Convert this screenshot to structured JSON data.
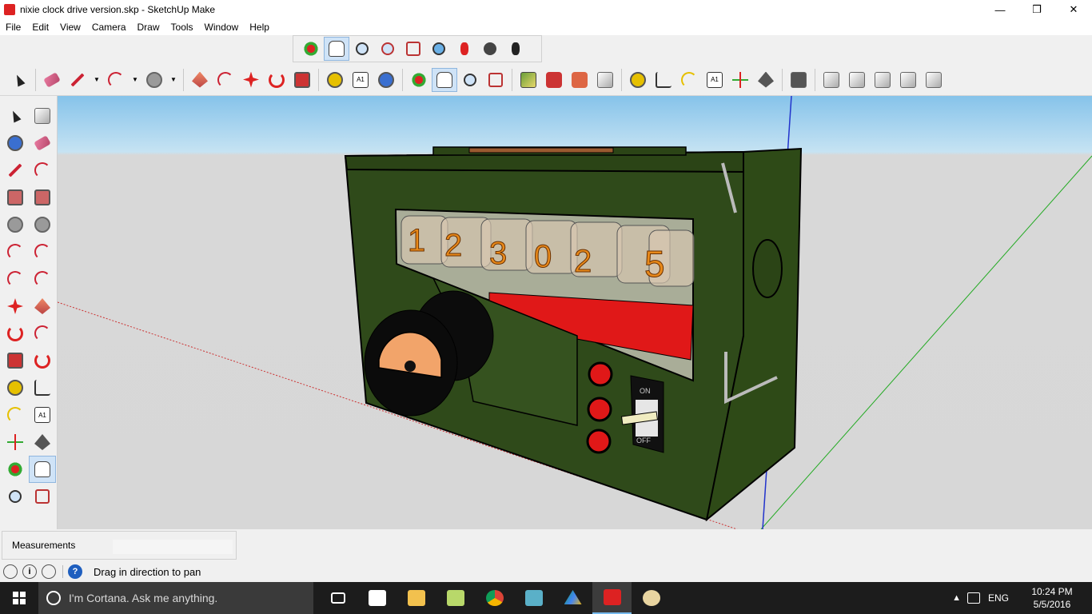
{
  "window": {
    "title": "nixie clock drive version.skp - SketchUp Make",
    "minimize": "—",
    "restore": "❒",
    "close": "✕"
  },
  "menu": [
    "File",
    "Edit",
    "View",
    "Camera",
    "Draw",
    "Tools",
    "Window",
    "Help"
  ],
  "toolbar": {
    "floating_tools": [
      "orbit-icon",
      "pan-icon",
      "zoom-icon",
      "zoom-window-icon",
      "zoom-extents-icon",
      "position-camera-icon",
      "walk-icon",
      "look-around-icon",
      "footprints-icon"
    ],
    "main_tools": [
      "select-icon",
      "eraser-icon",
      "pencil-icon",
      "arc-icon",
      "circle-icon",
      "push-pull-icon",
      "follow-me-icon",
      "move-icon",
      "rotate-icon",
      "scale-icon",
      "tape-icon",
      "text-icon",
      "paint-icon",
      "orbit-icon",
      "pan-icon",
      "zoom-icon",
      "zoom-extents-icon",
      "map-icon",
      "warehouse-icon",
      "extension-icon",
      "share-icon",
      "tape-icon",
      "dimension-icon",
      "protractor-icon",
      "text-icon",
      "axes-icon",
      "3d-text-icon",
      "section-icon",
      "view-iso-icon",
      "view-top-icon",
      "view-front-icon",
      "view-right-icon",
      "view-back-icon"
    ]
  },
  "text_tool_label": "A1",
  "viewport": {
    "nixie_digits": [
      "1",
      "2",
      "3",
      "0",
      "2",
      "5"
    ],
    "switch_on": "ON",
    "switch_off": "OFF"
  },
  "measurements": {
    "label": "Measurements",
    "value": ""
  },
  "status": {
    "help_icon": "?",
    "info_icon": "i",
    "message": "Drag in direction to pan"
  },
  "taskbar": {
    "search_placeholder": "I'm Cortana. Ask me anything.",
    "language": "ENG",
    "time": "10:24 PM",
    "date": "5/5/2016"
  },
  "colors": {
    "sky": "#86c3ea",
    "ground": "#d7d7d7",
    "case_green": "#2f4a1a",
    "accent_red": "#e01818",
    "nixie_orange": "#e8891a",
    "dial_peach": "#f2a46a"
  }
}
